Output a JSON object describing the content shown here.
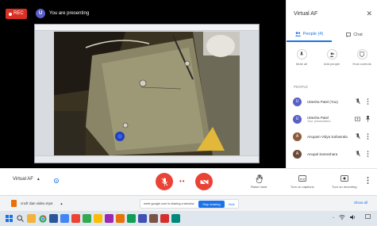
{
  "meeting": {
    "rec_label": "REC",
    "presenter_initial": "U",
    "presenter_status": "You are presenting"
  },
  "shared_window": {
    "title": "",
    "feed_description": "live camera view"
  },
  "side_panel": {
    "title": "Virtual AF",
    "tabs": [
      {
        "label": "People (4)",
        "icon": "people-icon",
        "active": true
      },
      {
        "label": "Chat",
        "icon": "chat-icon",
        "active": false
      }
    ],
    "actions": [
      {
        "label": "Mute all",
        "icon": "mic-icon"
      },
      {
        "label": "Add people",
        "icon": "add-person-icon"
      },
      {
        "label": "Host controls",
        "icon": "shield-icon"
      }
    ],
    "section_label": "PEOPLE",
    "participants": [
      {
        "initial": "U",
        "name": "Uttesha Patel (You)",
        "sub": "",
        "color": "#5b5fc7"
      },
      {
        "initial": "U",
        "name": "Uttesha Patel",
        "sub": "Your presentation",
        "color": "#5b5fc7"
      },
      {
        "initial": "A",
        "name": "Anupam Vidya Sahasrala",
        "sub": "",
        "color": "#8d5a3b"
      },
      {
        "initial": "A",
        "name": "Anupal Sameshara",
        "sub": "",
        "color": "#6b4a3a"
      }
    ]
  },
  "controls": {
    "meeting_name": "Virtual AF",
    "right_actions": [
      {
        "label": "Raise hand",
        "icon": "hand-icon"
      },
      {
        "label": "Turn on captions",
        "icon": "captions-icon"
      },
      {
        "label": "Turn on recording",
        "icon": "recording-icon"
      }
    ]
  },
  "download_bar": {
    "file_name": "cncfr dan video.mp4",
    "share_notice": "meet.google.com is sharing a window.",
    "stop_label": "Stop sharing",
    "hide_label": "Hide",
    "show_all_label": "Show all"
  },
  "taskbar": {
    "apps": [
      {
        "icon": "windows-icon",
        "color": "#1a73e8"
      },
      {
        "icon": "search-icon",
        "color": "#555"
      },
      {
        "icon": "file-explorer-icon",
        "color": "#f2b33d"
      },
      {
        "icon": "chrome-icon",
        "color": "#34a853"
      },
      {
        "icon": "word-icon",
        "color": "#2b579a"
      },
      {
        "icon": "app-icon",
        "color": "#4285f4"
      },
      {
        "icon": "app-icon",
        "color": "#ea4335"
      },
      {
        "icon": "app-icon",
        "color": "#34a853"
      },
      {
        "icon": "app-icon",
        "color": "#fbbc04"
      },
      {
        "icon": "app-icon",
        "color": "#9c27b0"
      },
      {
        "icon": "app-icon",
        "color": "#e8710a"
      },
      {
        "icon": "app-icon",
        "color": "#0f9d58"
      },
      {
        "icon": "app-icon",
        "color": "#3f51b5"
      },
      {
        "icon": "app-icon",
        "color": "#795548"
      },
      {
        "icon": "app-icon",
        "color": "#d32f2f"
      },
      {
        "icon": "app-icon",
        "color": "#00897b"
      }
    ],
    "tray_time": "",
    "tray_date": ""
  },
  "colors": {
    "accent": "#1a73e8",
    "danger": "#ea4335"
  }
}
